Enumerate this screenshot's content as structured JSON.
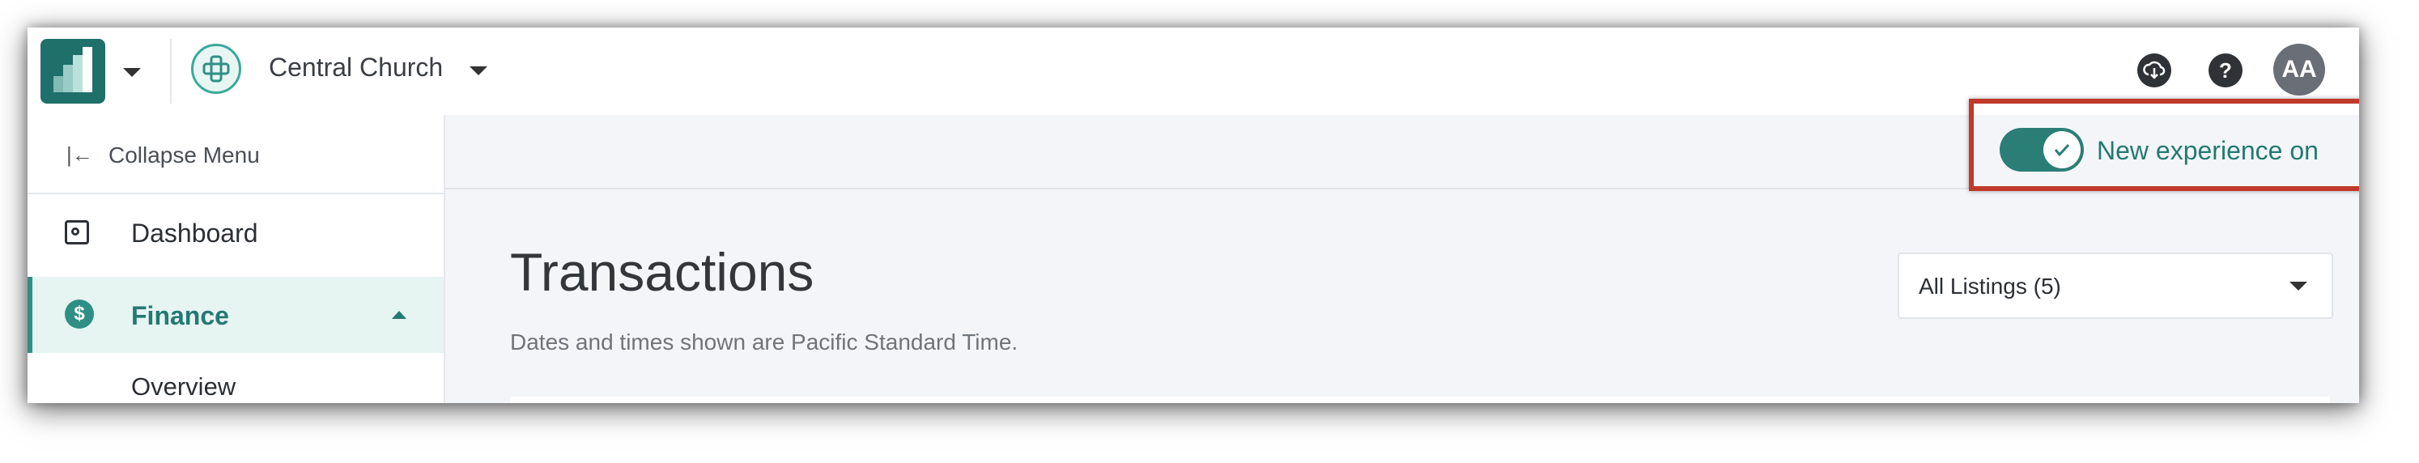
{
  "topbar": {
    "org_name": "Central Church",
    "avatar_initials": "AA",
    "help_glyph": "?"
  },
  "sidebar": {
    "collapse_label": "Collapse Menu",
    "items": [
      {
        "label": "Dashboard",
        "icon": "dashboard-icon"
      },
      {
        "label": "Finance",
        "icon": "dollar-icon",
        "expanded": true
      },
      {
        "label": "Overview"
      }
    ]
  },
  "main": {
    "toggle_label": "New experience on",
    "toggle_on": true,
    "title": "Transactions",
    "subtitle": "Dates and times shown are Pacific Standard Time.",
    "listing_select": "All Listings (5)"
  },
  "colors": {
    "accent": "#2f8f85",
    "highlight": "#c0392b"
  }
}
